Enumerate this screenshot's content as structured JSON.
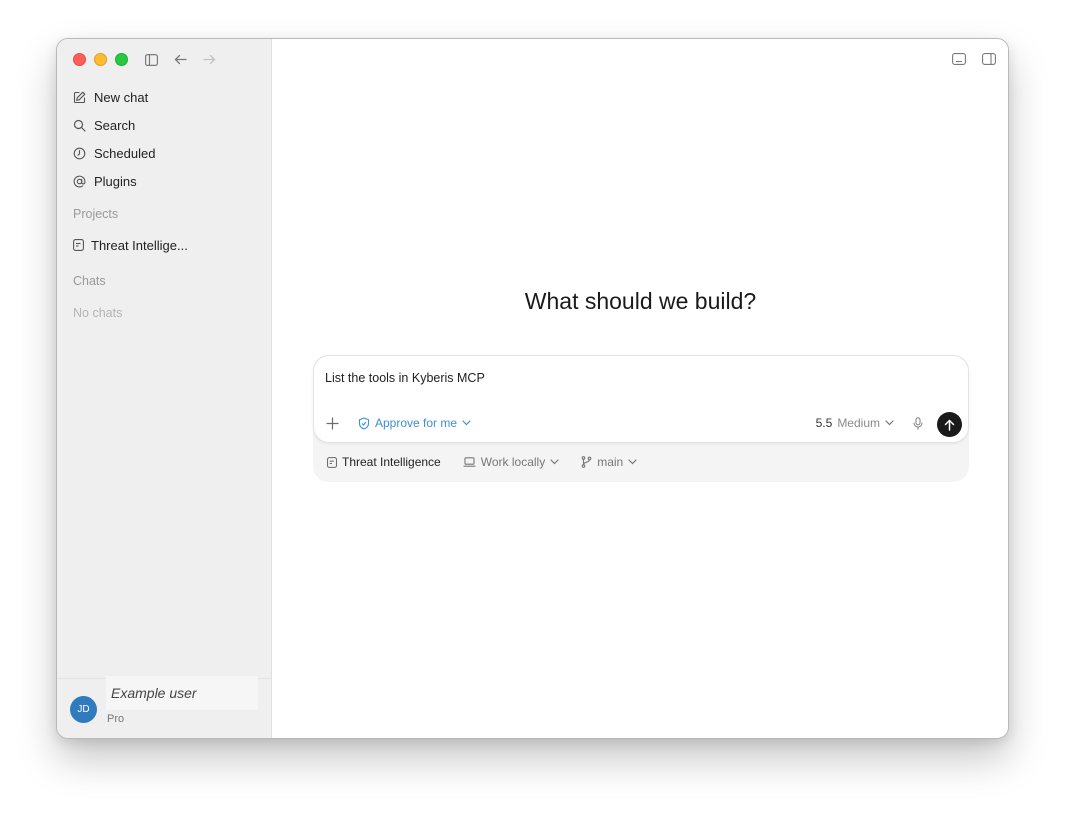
{
  "sidebar": {
    "nav": [
      {
        "label": "New chat",
        "icon": "edit-icon"
      },
      {
        "label": "Search",
        "icon": "search-icon"
      },
      {
        "label": "Scheduled",
        "icon": "clock-icon"
      },
      {
        "label": "Plugins",
        "icon": "at-sign-icon"
      }
    ],
    "projects_title": "Projects",
    "project": {
      "label": "Threat Intellige...",
      "icon": "folder-icon"
    },
    "chats_title": "Chats",
    "no_chats": "No chats",
    "user": {
      "initials": "JD",
      "name": "Example user",
      "plan": "Pro"
    }
  },
  "main": {
    "heading": "What should we build?",
    "composer": {
      "text": "List the tools in Kyberis MCP",
      "approve_label": "Approve for me",
      "model_version": "5.5",
      "model_level": "Medium"
    },
    "footer": {
      "project": "Threat Intelligence",
      "environment": "Work locally",
      "branch": "main"
    }
  },
  "colors": {
    "accent": "#3a8fd6",
    "sidebar_bg": "#efefef",
    "avatar": "#2f7bbd",
    "send_button": "#1a1a1a"
  }
}
